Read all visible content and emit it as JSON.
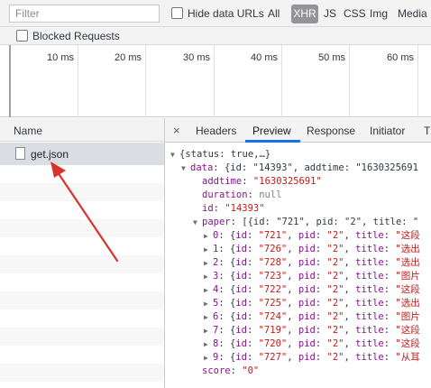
{
  "filter": {
    "placeholder": "Filter",
    "hide_data_urls_label": "Hide data URLs",
    "types": {
      "all": "All",
      "xhr": "XHR",
      "js": "JS",
      "css": "CSS",
      "img": "Img",
      "media": "Media"
    },
    "blocked_requests_label": "Blocked Requests"
  },
  "timeline": {
    "labels": [
      "10 ms",
      "20 ms",
      "30 ms",
      "40 ms",
      "50 ms",
      "60 ms"
    ]
  },
  "request_list": {
    "header": "Name",
    "requests": [
      {
        "name": "get.json"
      }
    ]
  },
  "details": {
    "close_glyph": "×",
    "tabs": {
      "headers": "Headers",
      "preview": "Preview",
      "response": "Response",
      "initiator": "Initiator",
      "more": "T"
    },
    "tree": {
      "root": "{status: true,…}",
      "data_key": "data",
      "data_summary": "{id: \"14393\", addtime: \"1630325691",
      "addtime_key": "addtime",
      "addtime_val": "\"1630325691\"",
      "duration_key": "duration",
      "duration_val": "null",
      "id_key": "id",
      "id_val": "\"14393\"",
      "paper_key": "paper",
      "paper_summary": "[{id: \"721\", pid: \"2\", title: \"",
      "items": [
        {
          "idx": "0",
          "id": "\"721\"",
          "title": "\"这段"
        },
        {
          "idx": "1",
          "id": "\"726\"",
          "title": "\"选出"
        },
        {
          "idx": "2",
          "id": "\"728\"",
          "title": "\"选出"
        },
        {
          "idx": "3",
          "id": "\"723\"",
          "title": "\"图片"
        },
        {
          "idx": "4",
          "id": "\"722\"",
          "title": "\"这段"
        },
        {
          "idx": "5",
          "id": "\"725\"",
          "title": "\"选出"
        },
        {
          "idx": "6",
          "id": "\"724\"",
          "title": "\"图片"
        },
        {
          "idx": "7",
          "id": "\"719\"",
          "title": "\"这段"
        },
        {
          "idx": "8",
          "id": "\"720\"",
          "title": "\"这段"
        },
        {
          "idx": "9",
          "id": "\"727\"",
          "title": "\"从耳"
        }
      ],
      "pid_val": "\"2\"",
      "score_key": "score",
      "score_val": "\"0\""
    }
  },
  "colors": {
    "annotation_arrow": "#d9342b",
    "xhr_active_bg": "#929497",
    "selected_row_bg": "#dadde2",
    "preview_tab_underline": "#1a73e8",
    "json_key": "#881391",
    "json_string": "#c41a16"
  }
}
